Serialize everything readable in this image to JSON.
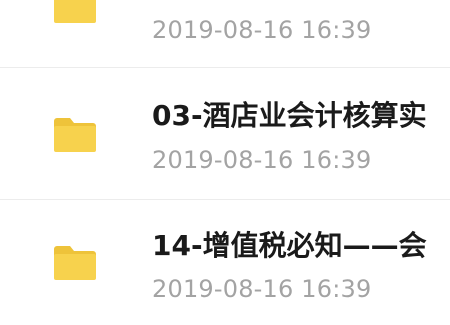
{
  "files": [
    {
      "name": "",
      "date": "2019-08-16 16:39"
    },
    {
      "name": "03-酒店业会计核算实",
      "date": "2019-08-16 16:39"
    },
    {
      "name": "14-增值税必知——会",
      "date": "2019-08-16 16:39"
    }
  ],
  "colors": {
    "folder_body": "#f7d24d",
    "folder_tab": "#eec33a",
    "date_text": "#a3a3a3",
    "name_text": "#1a1a1a"
  },
  "icons": {
    "folder": "folder-icon"
  }
}
